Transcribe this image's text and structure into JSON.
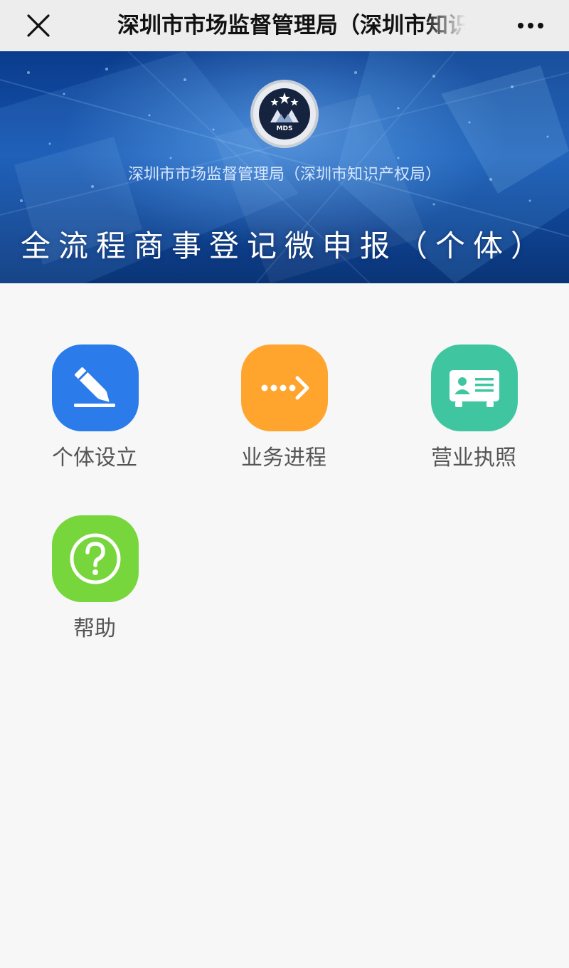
{
  "topbar": {
    "title": "深圳市市场监督管理局（深圳市知识产权局）",
    "close_icon": "close-icon",
    "more_icon": "more-icon"
  },
  "banner": {
    "logo_text": "MDS",
    "subtitle": "深圳市市场监督管理局（深圳市知识产权局）",
    "title": "全流程商事登记微申报（个体）"
  },
  "menu": {
    "items": [
      {
        "label": "个体设立",
        "icon": "pencil-icon",
        "color": "#2b7bea"
      },
      {
        "label": "业务进程",
        "icon": "progress-arrow-icon",
        "color": "#ffa42d"
      },
      {
        "label": "营业执照",
        "icon": "license-card-icon",
        "color": "#3fc6a0"
      },
      {
        "label": "帮助",
        "icon": "help-icon",
        "color": "#78d63d"
      }
    ]
  }
}
